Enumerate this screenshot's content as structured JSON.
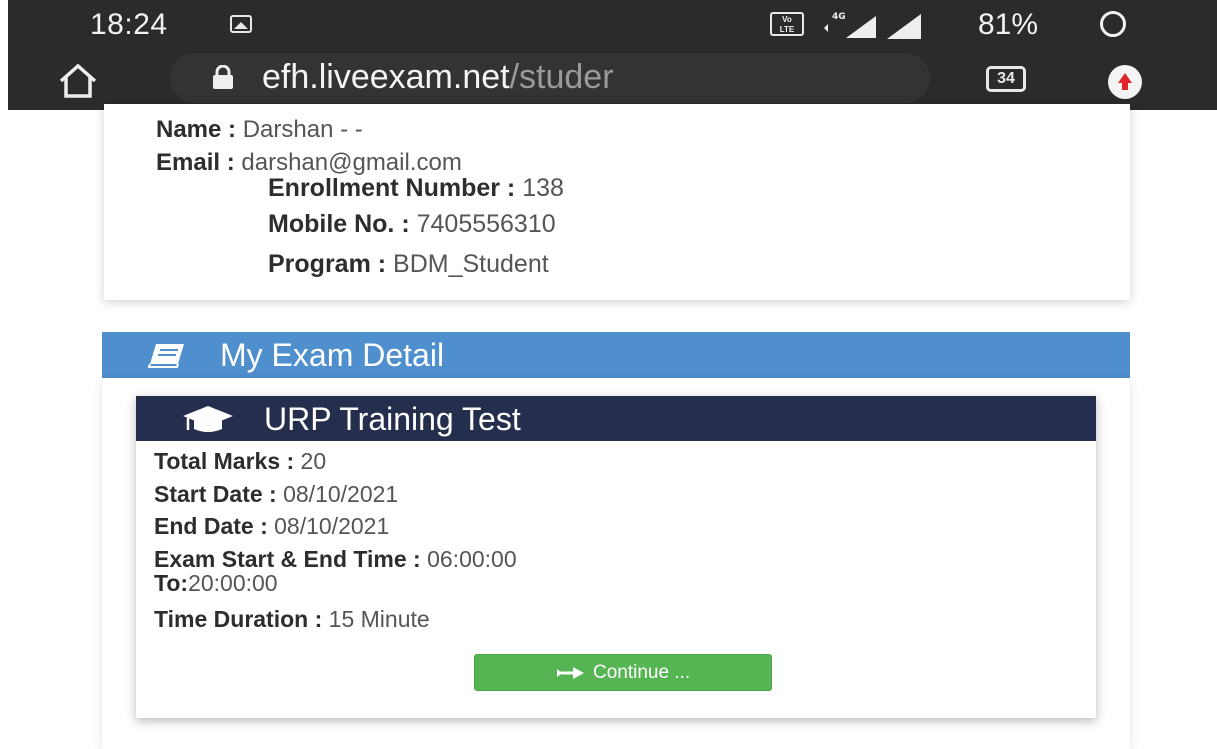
{
  "status_bar": {
    "time": "18:24",
    "network_badge": "VoLTE",
    "network_type": "4G",
    "battery": "81%"
  },
  "browser": {
    "url_domain": "efh.liveexam.net",
    "url_path": "/studer",
    "tab_count": "34"
  },
  "profile": {
    "name_label": "Name :",
    "name_value": "Darshan - -",
    "email_label": "Email :",
    "email_value": "darshan@gmail.com",
    "enrollment_label": "Enrollment Number :",
    "enrollment_value": "138",
    "mobile_label": "Mobile No. :",
    "mobile_value": "7405556310",
    "program_label": "Program :",
    "program_value": "BDM_Student"
  },
  "exam_section": {
    "title": "My Exam Detail",
    "exam": {
      "title": "URP Training Test",
      "total_marks_label": "Total Marks :",
      "total_marks_value": "20",
      "start_date_label": "Start Date :",
      "start_date_value": "08/10/2021",
      "end_date_label": "End Date :",
      "end_date_value": "08/10/2021",
      "time_label": "Exam Start & End Time :",
      "time_start": "06:00:00",
      "time_to_label": "To:",
      "time_end": "20:00:00",
      "duration_label": "Time Duration :",
      "duration_value": "15 Minute",
      "continue_label": "Continue ..."
    }
  },
  "colors": {
    "section_header": "#4f8fcd",
    "exam_header": "#252e4d",
    "continue_button": "#55b553",
    "chrome": "#2b2b2b"
  },
  "icons": [
    "image-icon",
    "volte-icon",
    "signal-4g-icon",
    "signal-icon",
    "battery-icon",
    "home-icon",
    "lock-icon",
    "tabs-icon",
    "update-icon",
    "book-icon",
    "graduation-cap-icon",
    "arrow-right-icon"
  ]
}
